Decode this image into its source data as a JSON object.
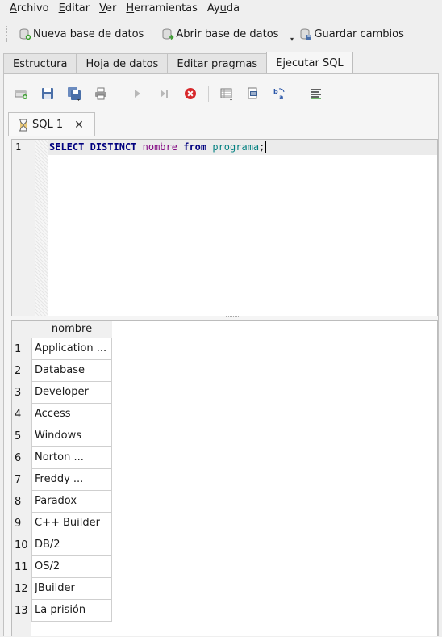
{
  "menu": [
    {
      "acc": "A",
      "rest": "rchivo"
    },
    {
      "acc": "E",
      "rest": "ditar"
    },
    {
      "acc": "V",
      "rest": "er"
    },
    {
      "acc": "H",
      "rest": "erramientas"
    },
    {
      "pre": "Ay",
      "acc": "u",
      "rest": "da"
    }
  ],
  "toolbar": {
    "new_db": "Nueva base de datos",
    "open_db": "Abrir base de datos",
    "save": "Guardar cambios"
  },
  "tabs": [
    "Estructura",
    "Hoja de datos",
    "Editar pragmas",
    "Ejecutar SQL"
  ],
  "sql_tab": {
    "label": "SQL 1",
    "close": "✕"
  },
  "editor": {
    "line_number": "1",
    "tokens": {
      "select": "SELECT",
      "distinct": "DISTINCT",
      "column": "nombre",
      "from": "from",
      "table": "programa",
      "semicolon": ";"
    }
  },
  "results": {
    "column": "nombre",
    "rows": [
      {
        "n": "1",
        "v": "Application ..."
      },
      {
        "n": "2",
        "v": "Database"
      },
      {
        "n": "3",
        "v": "Developer"
      },
      {
        "n": "4",
        "v": "Access"
      },
      {
        "n": "5",
        "v": "Windows"
      },
      {
        "n": "6",
        "v": "Norton ..."
      },
      {
        "n": "7",
        "v": "Freddy ..."
      },
      {
        "n": "8",
        "v": "Paradox"
      },
      {
        "n": "9",
        "v": "C++ Builder"
      },
      {
        "n": "10",
        "v": "DB/2"
      },
      {
        "n": "11",
        "v": "OS/2"
      },
      {
        "n": "12",
        "v": "JBuilder"
      },
      {
        "n": "13",
        "v": "La prisión"
      }
    ]
  }
}
